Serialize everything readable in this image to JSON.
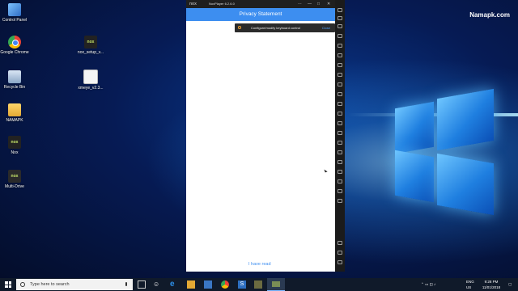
{
  "watermark": "Namapk.com",
  "desktop": {
    "icons": [
      {
        "label": "Control Panel"
      },
      {
        "label": "Google Chrome"
      },
      {
        "label": "Recycle Bin"
      },
      {
        "label": "NAMAPK"
      },
      {
        "label": "Nox"
      },
      {
        "label": "Multi-Drive"
      },
      {
        "label": "nox_setup_v..."
      },
      {
        "label": "xmeye_v2.3..."
      }
    ]
  },
  "nox": {
    "brand": "nox",
    "title": "NoxPlayer 6.2.6.0",
    "controls": [
      "⋯",
      "—",
      "□",
      "✕"
    ]
  },
  "app": {
    "bar_title": "Privacy Statement",
    "action_label": "I have read"
  },
  "toast": {
    "message": "Configure/modify keyboard control",
    "close_label": "Close"
  },
  "taskbar": {
    "search_placeholder": "Type here to search",
    "lang": "ENG",
    "region": "US",
    "time": "9:28 PM",
    "date": "11/01/2018"
  }
}
